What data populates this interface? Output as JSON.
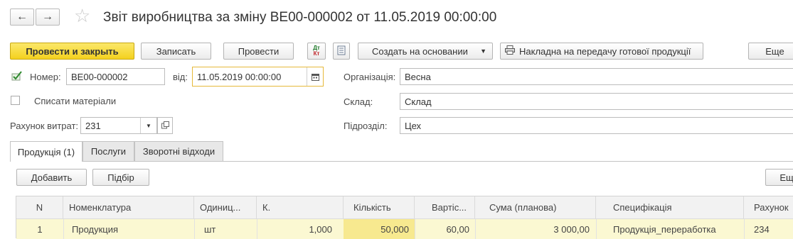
{
  "header": {
    "back_label": "←",
    "forward_label": "→",
    "title": "Звіт виробництва за зміну ВЕ00-000002 от 11.05.2019 00:00:00"
  },
  "toolbar": {
    "post_close": "Провести и закрыть",
    "save": "Записать",
    "post": "Провести",
    "dtkt_top": "Дт",
    "dtkt_bottom": "Кт",
    "create_based": "Создать на основании",
    "invoice": "Накладна на передачу готової продукції",
    "more": "Еще"
  },
  "form": {
    "number_label": "Номер:",
    "number_value": "ВЕ00-000002",
    "date_label": "від:",
    "date_value": "11.05.2019 00:00:00",
    "writeoff_label": "Списати  матеріали",
    "account_label": "Рахунок витрат:",
    "account_value": "231",
    "org_label": "Організація:",
    "org_value": "Весна",
    "warehouse_label": "Склад:",
    "warehouse_value": "Склад",
    "division_label": "Підрозділ:",
    "division_value": "Цех"
  },
  "tabs": [
    {
      "label": "Продукція (1)"
    },
    {
      "label": "Послуги"
    },
    {
      "label": "Зворотні відходи"
    }
  ],
  "table_toolbar": {
    "add": "Добавить",
    "pick": "Підбір",
    "more": "Ещ"
  },
  "table": {
    "columns": [
      "N",
      "Номенклатура",
      "Одиниц...",
      "К.",
      "Кількість",
      "Вартіс...",
      "Сума (планова)",
      "Специфікація",
      "Рахунок"
    ],
    "rows": [
      [
        "1",
        "Продукция",
        "шт",
        "1,000",
        "50,000",
        "60,00",
        "3 000,00",
        "Продукція_переработка",
        "234"
      ]
    ]
  },
  "colors": {
    "accent_button": "#f4d11e",
    "selected_row": "#fbf8d2",
    "active_cell": "#f7e98f",
    "focus_border": "#e6b93a"
  }
}
